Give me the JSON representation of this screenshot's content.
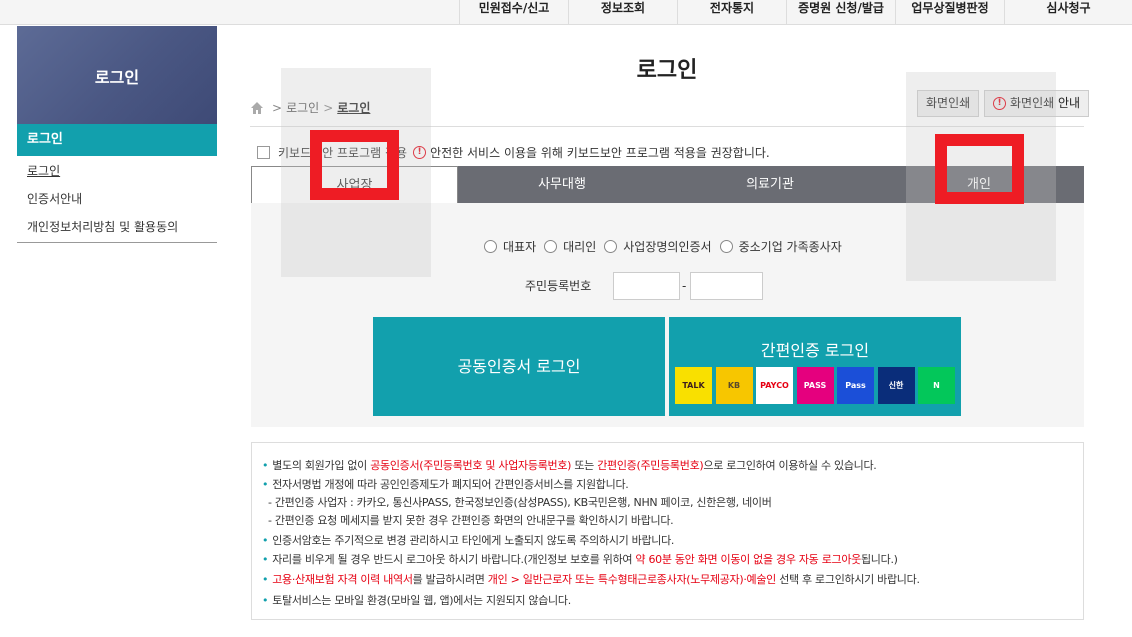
{
  "topnav": [
    "민원접수/신고",
    "정보조회",
    "전자통지",
    "증명원 신청/발급",
    "업무상질병판정",
    "심사청구"
  ],
  "sidebar": {
    "title": "로그인",
    "active": "로그인",
    "items": [
      "로그인",
      "인증서안내",
      "개인정보처리방침 및 활용동의"
    ]
  },
  "page_title": "로그인",
  "breadcrumb": {
    "parent": "로그인",
    "current": "로그인"
  },
  "print_button": "화면인쇄",
  "print_guide_button": "화면인쇄 안내",
  "keyboard": {
    "label": "키보드보안 프로그램 적용",
    "notice": "안전한 서비스 이용을 위해 키보드보안 프로그램 적용을 권장합니다."
  },
  "tabs": [
    "사업장",
    "사무대행",
    "의료기관",
    "개인"
  ],
  "radios": [
    "대표자",
    "대리인",
    "사업장명의인증서",
    "중소기업 가족종사자"
  ],
  "ssn_label": "주민등록번호",
  "ssn_dash": "-",
  "cert_login": "공동인증서 로그인",
  "simple_login": "간편인증 로그인",
  "logos": [
    {
      "name": "kakaotalk-icon",
      "text": "TALK",
      "bg": "#f9e000",
      "fg": "#3c1e1e"
    },
    {
      "name": "kb-bank-icon",
      "text": "KB",
      "bg": "#f7c600",
      "fg": "#5a4a2c"
    },
    {
      "name": "payco-icon",
      "text": "PAYCO",
      "bg": "#ffffff",
      "fg": "#e60012"
    },
    {
      "name": "pass-icon",
      "text": "PASS",
      "bg": "#e5007e",
      "fg": "#ffffff"
    },
    {
      "name": "samsung-pass-icon",
      "text": "Pass",
      "bg": "#1b4fd8",
      "fg": "#ffffff"
    },
    {
      "name": "shinhan-bank-icon",
      "text": "신한",
      "bg": "#0a2d7a",
      "fg": "#ffffff"
    },
    {
      "name": "naver-icon",
      "text": "N",
      "bg": "#03c75a",
      "fg": "#ffffff"
    }
  ],
  "info": {
    "l1a": "별도의 회원가입 없이 ",
    "l1b": "공동인증서(주민등록번호 및 사업자등록번호)",
    "l1c": " 또는 ",
    "l1d": "간편인증(주민등록번호)",
    "l1e": "으로 로그인하여 이용하실 수 있습니다.",
    "l2": "전자서명법 개정에 따라 공인인증제도가 폐지되어 간편인증서비스를 지원합니다.",
    "l3": "- 간편인증 사업자 : 카카오, 통신사PASS, 한국정보인증(삼성PASS), KB국민은행, NHN 페이코, 신한은행, 네이버",
    "l4": "- 간편인증 요청 메세지를 받지 못한 경우 간편인증 화면의 안내문구를 확인하시기 바랍니다.",
    "l5": "인증서암호는 주기적으로 변경 관리하시고 타인에게 노출되지 않도록 주의하시기 바랍니다.",
    "l6a": "자리를 비우게 될 경우 반드시 로그아웃 하시기 바랍니다.(개인정보 보호를 위하여 ",
    "l6b": "약 60분 동안 화면 이동이 없을 경우 자동 로그아웃",
    "l6c": "됩니다.)",
    "l7a": "고용·산재보험 자격 이력 내역서",
    "l7b": "를 발급하시려면 ",
    "l7c": "개인 > 일반근로자 또는 특수형태근로종사자(노무제공자)·예술인",
    "l7d": " 선택 후 로그인하시기 바랍니다.",
    "l8": "토탈서비스는 모바일 환경(모바일 웹, 앱)에서는 지원되지 않습니다."
  }
}
